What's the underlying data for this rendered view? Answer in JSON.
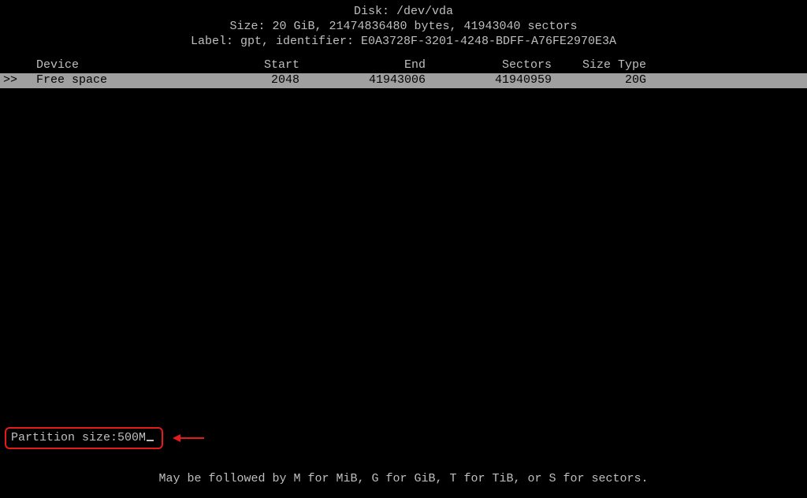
{
  "header": {
    "disk_line": "Disk: /dev/vda",
    "size_line": "Size: 20 GiB, 21474836480 bytes, 41943040 sectors",
    "label_line": "Label: gpt, identifier: E0A3728F-3201-4248-BDFF-A76FE2970E3A"
  },
  "table": {
    "columns": {
      "device": "Device",
      "start": "Start",
      "end": "End",
      "sectors": "Sectors",
      "size": "Size",
      "type": "Type"
    },
    "rows": [
      {
        "marker": ">>",
        "device": "Free space",
        "start": "2048",
        "end": "41943006",
        "sectors": "41940959",
        "size": "20G",
        "type": "",
        "selected": true
      }
    ]
  },
  "prompt": {
    "label": "Partition size: ",
    "value": "500M"
  },
  "hint": "May be followed by M for MiB, G for GiB, T for TiB, or S for sectors."
}
